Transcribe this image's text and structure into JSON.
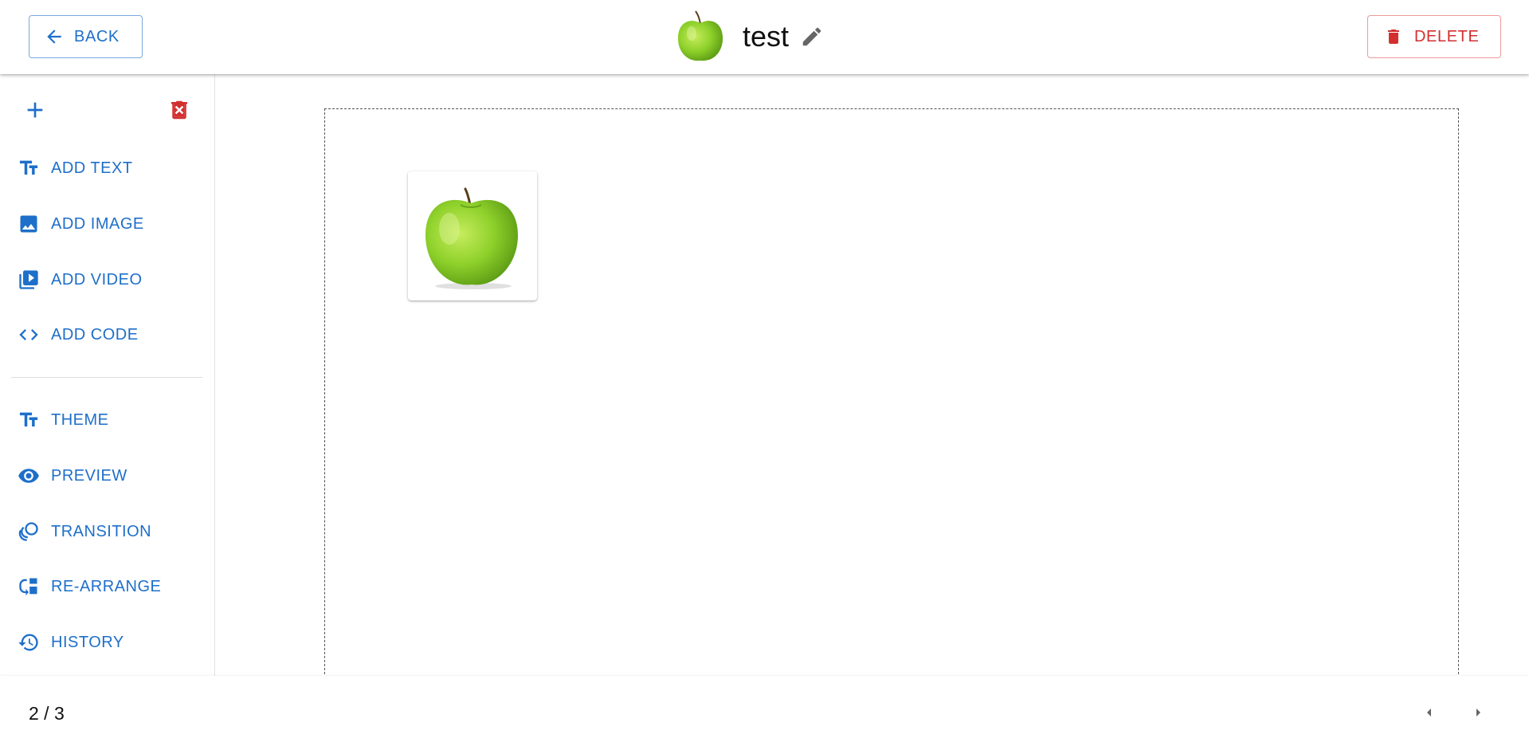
{
  "header": {
    "back_label": "BACK",
    "title": "test",
    "delete_label": "DELETE"
  },
  "sidebar": {
    "items": [
      {
        "label": "ADD TEXT",
        "icon": "text-fields-icon"
      },
      {
        "label": "ADD IMAGE",
        "icon": "image-icon"
      },
      {
        "label": "ADD VIDEO",
        "icon": "video-library-icon"
      },
      {
        "label": "ADD CODE",
        "icon": "code-icon"
      },
      {
        "label": "THEME",
        "icon": "text-fields-icon"
      },
      {
        "label": "PREVIEW",
        "icon": "eye-icon"
      },
      {
        "label": "TRANSITION",
        "icon": "animation-icon"
      },
      {
        "label": "RE-ARRANGE",
        "icon": "rearrange-icon"
      },
      {
        "label": "HISTORY",
        "icon": "history-icon"
      }
    ]
  },
  "footer": {
    "page_counter": "2 / 3"
  },
  "colors": {
    "primary": "#1e6fc9",
    "danger": "#d32f2f",
    "apple_green": "#8fd12b"
  }
}
